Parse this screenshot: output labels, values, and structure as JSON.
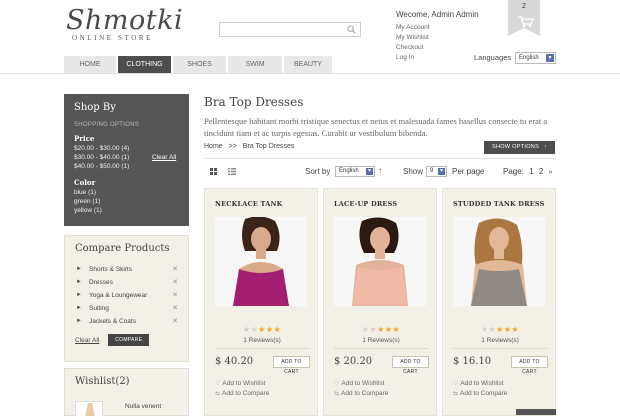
{
  "header": {
    "logo_script": "Shmotki",
    "logo_sub": "ONLINE STORE",
    "search_placeholder": "",
    "welcome": "Wecome, Admin Admin",
    "account_links": [
      "My Account",
      "My Wishlist",
      "Checkout",
      "Log In"
    ],
    "cart_count": "2",
    "languages_label": "Languages",
    "language_value": "English"
  },
  "nav": {
    "tabs": [
      {
        "label": "HOME",
        "active": false
      },
      {
        "label": "CLOTHING",
        "active": true
      },
      {
        "label": "SHOES",
        "active": false
      },
      {
        "label": "SWIM",
        "active": false
      },
      {
        "label": "BEAUTY",
        "active": false
      }
    ]
  },
  "shopby": {
    "title": "Shop By",
    "options_title": "SHOPPING OPTIONS",
    "price_title": "Price",
    "prices": [
      "$20.00 - $30.00 (4)",
      "$30.00 - $40.00 (1)",
      "$40.00 - $50.00 (1)"
    ],
    "clear_all": "Clear All",
    "color_title": "Color",
    "colors": [
      "blue (1)",
      "green (1)",
      "yellow (1)"
    ]
  },
  "compare": {
    "title": "Compare Products",
    "items": [
      "Shorts & Skirts",
      "Dresses",
      "Yoga & Loungewear",
      "Suiting",
      "Jackets & Coats"
    ],
    "clear_all": "Clear All",
    "compare_button": "COMPARE"
  },
  "wishlist": {
    "title": "Wishlist(2)",
    "item_name": "Nulla venent"
  },
  "main": {
    "title": "Bra Top Dresses",
    "description": "Pellentesque habitant morbi tristique senectus et netus et malesuada fames hasellus consecte tu erat a tincidunt tiam et  ac turpis egestas. Curabit ur vestibulum bibenda.",
    "breadcrumb": [
      "Home",
      ">>",
      "Bra Top Dresses"
    ],
    "show_options": "SHOW OPTIONS",
    "sort_by_label": "Sort by",
    "sort_value": "English",
    "show_label": "Show",
    "show_value": "9",
    "per_page_label": "Per page",
    "page_label": "Page:",
    "pages": [
      "1",
      "2"
    ],
    "next_icon": "double-chevron-right"
  },
  "products": [
    {
      "name": "NECKLACE TANK",
      "rating": 3,
      "reviews": "1 Reviews(s)",
      "price": "$ 40.20",
      "add_to_cart": "ADD TO CART",
      "wishlist": "Add to Wishlist",
      "compare": "Add to Compare",
      "dress_color": "#a11f6e"
    },
    {
      "name": "LACE-UP DRESS",
      "rating": 3,
      "reviews": "1 Reviews(s)",
      "price": "$ 20.20",
      "add_to_cart": "ADD TO CART",
      "wishlist": "Add to Wishlist",
      "compare": "Add to Compare",
      "dress_color": "#f0b9a6"
    },
    {
      "name": "STUDDED TANK DRESS",
      "rating": 3,
      "reviews": "1 Reviews(s)",
      "price": "$ 16.10",
      "add_to_cart": "ADD TO CART",
      "wishlist": "Add to Wishlist",
      "compare": "Add to Compare",
      "dress_color": "#8f8a86"
    }
  ],
  "colors": {
    "dark_panel": "#555555",
    "beige_panel": "#f3f1e7",
    "star": "#f2a623",
    "select_arrow": "#5a6fb0"
  }
}
